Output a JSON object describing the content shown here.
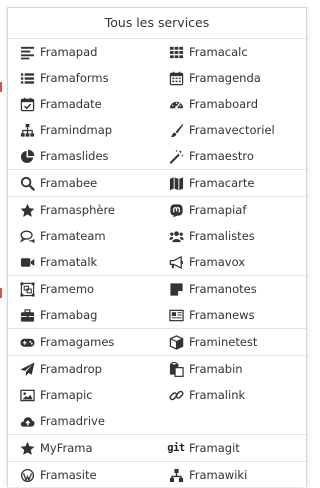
{
  "menu": {
    "title": "Tous les services",
    "sections": [
      {
        "rows": [
          [
            {
              "label": "Framapad",
              "icon": "align-left-icon"
            },
            {
              "label": "Framacalc",
              "icon": "table-icon"
            }
          ],
          [
            {
              "label": "Framaforms",
              "icon": "list-icon"
            },
            {
              "label": "Framagenda",
              "icon": "calendar-icon"
            }
          ],
          [
            {
              "label": "Framadate",
              "icon": "calendar-check-icon"
            },
            {
              "label": "Framaboard",
              "icon": "dashboard-icon"
            }
          ],
          [
            {
              "label": "Framindmap",
              "icon": "sitemap-icon"
            },
            {
              "label": "Framavectoriel",
              "icon": "paint-brush-icon"
            }
          ],
          [
            {
              "label": "Framaslides",
              "icon": "pie-chart-icon"
            },
            {
              "label": "Framaestro",
              "icon": "magic-wand-icon"
            }
          ]
        ]
      },
      {
        "rows": [
          [
            {
              "label": "Framabee",
              "icon": "search-icon"
            },
            {
              "label": "Framacarte",
              "icon": "map-icon"
            }
          ]
        ]
      },
      {
        "rows": [
          [
            {
              "label": "Framasphère",
              "icon": "star-icon"
            },
            {
              "label": "Framapiaf",
              "icon": "mastodon-icon"
            }
          ],
          [
            {
              "label": "Framateam",
              "icon": "comments-icon"
            },
            {
              "label": "Framalistes",
              "icon": "group-icon"
            }
          ],
          [
            {
              "label": "Framatalk",
              "icon": "video-camera-icon"
            },
            {
              "label": "Framavox",
              "icon": "bullhorn-icon"
            }
          ]
        ]
      },
      {
        "rows": [
          [
            {
              "label": "Framemo",
              "icon": "object-group-icon"
            },
            {
              "label": "Framanotes",
              "icon": "sticky-note-icon"
            }
          ],
          [
            {
              "label": "Framabag",
              "icon": "briefcase-icon"
            },
            {
              "label": "Framanews",
              "icon": "newspaper-icon"
            }
          ]
        ]
      },
      {
        "rows": [
          [
            {
              "label": "Framagames",
              "icon": "gamepad-icon"
            },
            {
              "label": "Framinetest",
              "icon": "cube-icon"
            }
          ]
        ]
      },
      {
        "rows": [
          [
            {
              "label": "Framadrop",
              "icon": "paper-plane-icon"
            },
            {
              "label": "Framabin",
              "icon": "paste-icon"
            }
          ],
          [
            {
              "label": "Framapic",
              "icon": "picture-icon"
            },
            {
              "label": "Framalink",
              "icon": "link-icon"
            }
          ],
          [
            {
              "label": "Framadrive",
              "icon": "cloud-upload-icon"
            },
            null
          ]
        ]
      },
      {
        "rows": [
          [
            {
              "label": "MyFrama",
              "icon": "star-icon"
            },
            {
              "label": "Framagit",
              "icon": "git-icon",
              "glyph": "git"
            }
          ]
        ]
      },
      {
        "rows": [
          [
            {
              "label": "Framasite",
              "icon": "wordpress-icon"
            },
            {
              "label": "Framawiki",
              "icon": "wiki-sitemap-icon"
            }
          ]
        ]
      }
    ]
  }
}
